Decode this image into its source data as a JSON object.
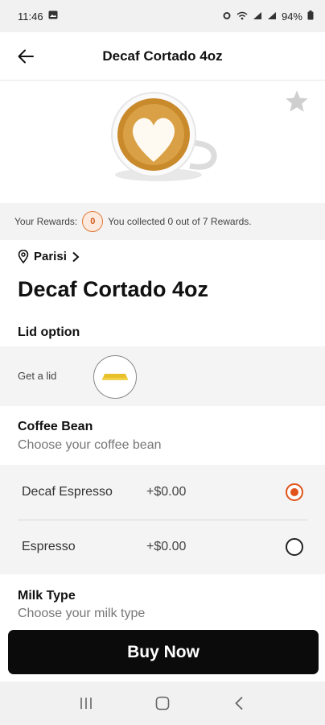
{
  "status_bar": {
    "time": "11:46",
    "battery": "94%"
  },
  "header": {
    "title": "Decaf Cortado 4oz"
  },
  "rewards": {
    "label": "Your Rewards:",
    "count": "0",
    "message": "You collected 0 out of 7 Rewards."
  },
  "store": {
    "name": "Parisi"
  },
  "product": {
    "name": "Decaf Cortado 4oz"
  },
  "lid": {
    "title": "Lid option",
    "option_label": "Get a lid"
  },
  "coffee_bean": {
    "title": "Coffee Bean",
    "subtitle": "Choose your coffee bean",
    "options": [
      {
        "label": "Decaf Espresso",
        "price": "+$0.00",
        "selected": true
      },
      {
        "label": "Espresso",
        "price": "+$0.00",
        "selected": false
      }
    ]
  },
  "milk": {
    "title": "Milk Type",
    "subtitle": "Choose your milk type"
  },
  "buy_button": {
    "label": "Buy Now"
  },
  "colors": {
    "accent": "#e0531a",
    "button_bg": "#0b0b0b",
    "panel_bg": "#f4f4f4"
  }
}
